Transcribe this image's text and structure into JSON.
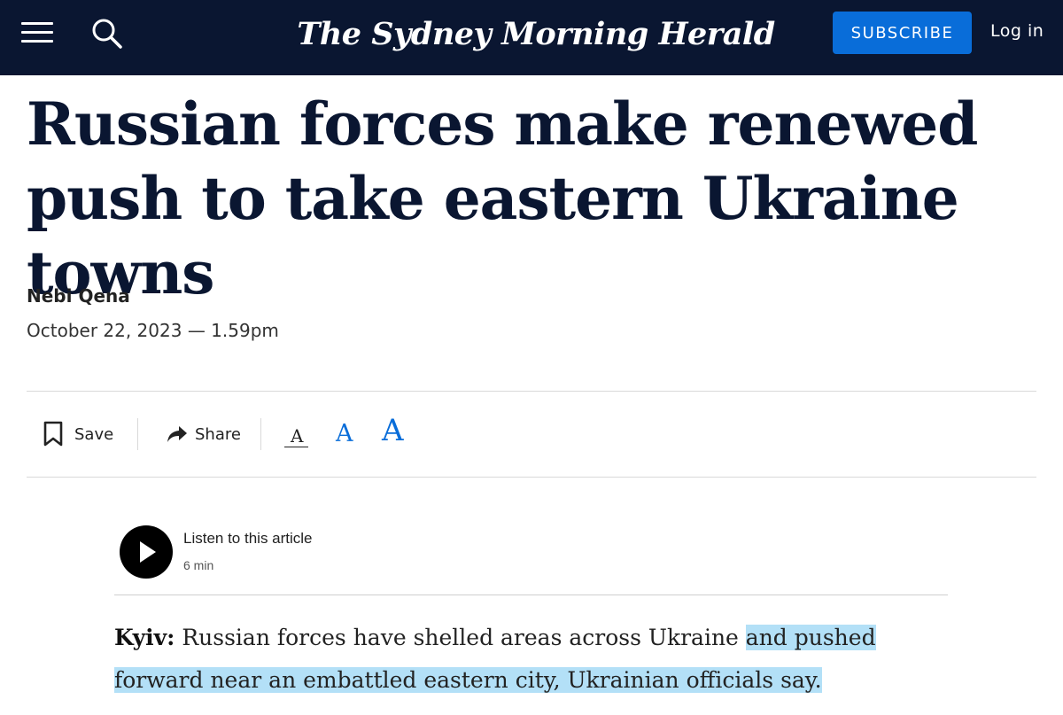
{
  "header": {
    "masthead": "The Sydney Morning Herald",
    "subscribe_label": "SUBSCRIBE",
    "login_label": "Log in",
    "menu_icon": "hamburger-menu-icon",
    "search_icon": "search-icon",
    "background_color": "#0a1631",
    "accent_color": "#096dd9"
  },
  "article": {
    "headline": "Russian forces make renewed push to take eastern Ukraine towns",
    "author": "Nebi Qena",
    "dateline": "October 22, 2023 — 1.59pm"
  },
  "toolbar": {
    "save_label": "Save",
    "share_label": "Share",
    "font_size_options": [
      "A",
      "A",
      "A"
    ]
  },
  "audio": {
    "title": "Listen to this article",
    "duration": "6 min"
  },
  "body": {
    "dateline_location": "Kyiv:",
    "lede_plain": " Russian forces have shelled areas across Ukraine ",
    "lede_highlighted": "and pushed forward near an embattled eastern city, Ukrainian officials say.",
    "highlight_color": "#b3e0f7"
  }
}
